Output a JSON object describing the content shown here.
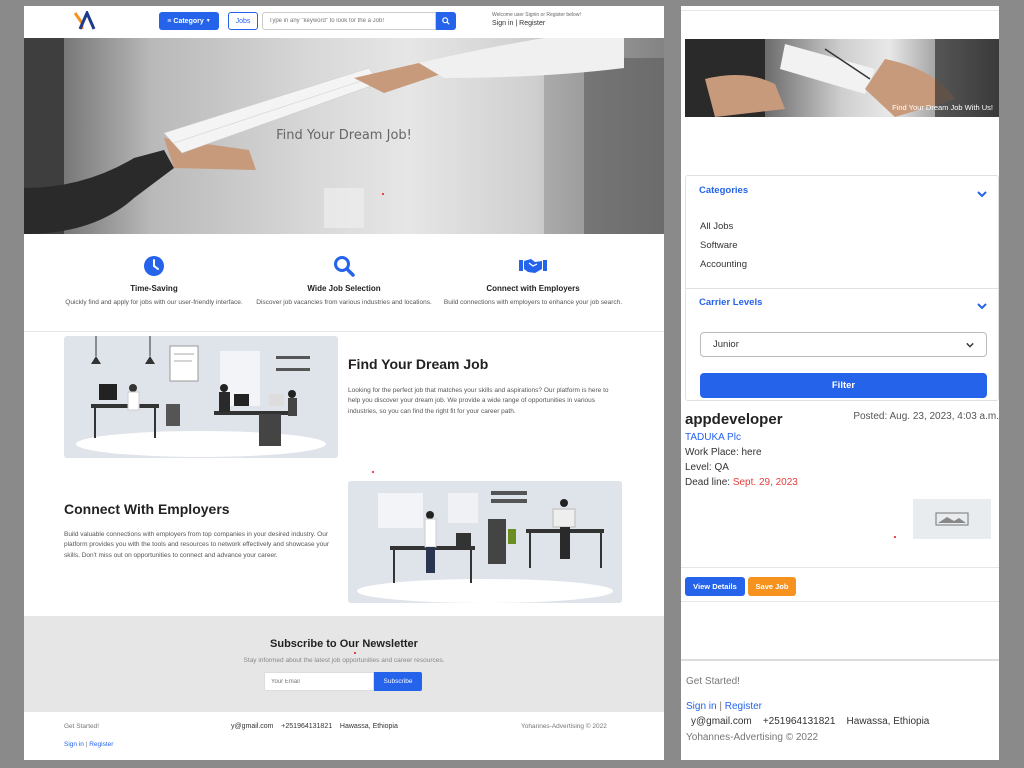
{
  "nav": {
    "category_label": "Category",
    "jobs_label": "Jobs",
    "search_placeholder": "Type in any \"keyword\" to look for the a Job!",
    "welcome_text": "Welcome user Signin or Register below!",
    "signin_label": "Sign in",
    "separator": "|",
    "register_label": "Register"
  },
  "hero": {
    "title": "Find Your Dream Job!"
  },
  "features": [
    {
      "title": "Time-Saving",
      "text": "Quickly find and apply for jobs with our user-friendly interface.",
      "icon": "clock-icon"
    },
    {
      "title": "Wide Job Selection",
      "text": "Discover job vacancies from various industries and locations.",
      "icon": "search-icon"
    },
    {
      "title": "Connect with Employers",
      "text": "Build connections with employers to enhance your job search.",
      "icon": "handshake-icon"
    }
  ],
  "sections": {
    "find": {
      "title": "Find Your Dream Job",
      "text": "Looking for the perfect job that matches your skills and aspirations? Our platform is here to help you discover your dream job. We provide a wide range of opportunities in various industries, so you can find the right fit for your career path."
    },
    "connect": {
      "title": "Connect With Employers",
      "text": "Build valuable connections with employers from top companies in your desired industry. Our platform provides you with the tools and resources to network effectively and showcase your skills. Don't miss out on opportunities to connect and advance your career."
    }
  },
  "newsletter": {
    "title": "Subscribe to Our Newsletter",
    "subtitle": "Stay informed about the latest job opportunities and career resources.",
    "email_placeholder": "Your Email",
    "button": "Subscribe"
  },
  "footer": {
    "get_started": "Get Started!",
    "email": "y@gmail.com",
    "phone": "+251964131821",
    "location": "Hawassa, Ethiopia",
    "copyright": "Yohannes-Advertising © 2022",
    "signin": "Sign in",
    "separator": "|",
    "register": "Register"
  },
  "right": {
    "banner_text": "Find Your Dream Job With Us!",
    "categories_heading": "Categories",
    "categories": [
      "All Jobs",
      "Software",
      "Accounting"
    ],
    "levels_heading": "Carrier Levels",
    "selected_level": "Junior",
    "filter_label": "Filter",
    "job": {
      "title": "appdeveloper",
      "posted": "Posted: Aug. 23, 2023, 4:03 a.m.",
      "company": "TADUKA Plc",
      "workplace": "Work Place: here",
      "level": "Level: QA",
      "deadline_label": "Dead line:",
      "deadline_value": "Sept. 29, 2023",
      "view_label": "View Details",
      "save_label": "Save Job"
    }
  },
  "colors": {
    "accent": "#2563eb",
    "save": "#f6921e",
    "deadline": "#e53e3e"
  }
}
